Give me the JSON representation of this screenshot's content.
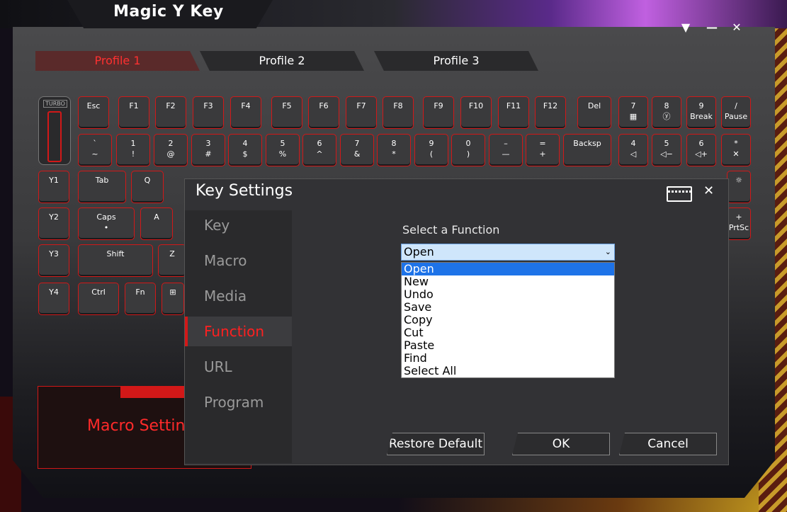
{
  "app": {
    "title": "Magic Y Key",
    "window_controls": {
      "dropdown": "▼",
      "minimize": "—",
      "close": "✕"
    }
  },
  "profiles": [
    {
      "label": "Profile 1",
      "active": true
    },
    {
      "label": "Profile 2",
      "active": false
    },
    {
      "label": "Profile 3",
      "active": false
    }
  ],
  "keyboard": {
    "turbo_label": "TURBO",
    "row_fn": [
      "Esc",
      "F1",
      "F2",
      "F3",
      "F4",
      "F5",
      "F6",
      "F7",
      "F8",
      "F9",
      "F10",
      "F11",
      "F12",
      "Del"
    ],
    "row_num": [
      {
        "top": "`",
        "bot": "~"
      },
      {
        "top": "1",
        "bot": "!"
      },
      {
        "top": "2",
        "bot": "@"
      },
      {
        "top": "3",
        "bot": "#"
      },
      {
        "top": "4",
        "bot": "$"
      },
      {
        "top": "5",
        "bot": "%"
      },
      {
        "top": "6",
        "bot": "^"
      },
      {
        "top": "7",
        "bot": "&"
      },
      {
        "top": "8",
        "bot": "*"
      },
      {
        "top": "9",
        "bot": "("
      },
      {
        "top": "0",
        "bot": ")"
      },
      {
        "top": "–",
        "bot": "—"
      },
      {
        "top": "=",
        "bot": "+"
      },
      {
        "top": "Backsp",
        "bot": ""
      }
    ],
    "numpad_row1": [
      {
        "top": "7",
        "bot": "▦"
      },
      {
        "top": "8",
        "bot": "ⓨ"
      },
      {
        "top": "9",
        "bot": "Break"
      },
      {
        "top": "/",
        "bot": "Pause"
      }
    ],
    "numpad_row2": [
      {
        "top": "4",
        "bot": "◁"
      },
      {
        "top": "5",
        "bot": "◁−"
      },
      {
        "top": "6",
        "bot": "◁+"
      },
      {
        "top": "*",
        "bot": "✕"
      }
    ],
    "y_keys": [
      "Y1",
      "Y2",
      "Y3",
      "Y4"
    ],
    "row_tab": [
      "Tab",
      "Q"
    ],
    "row_caps": [
      "Caps",
      "A"
    ],
    "row_shift": [
      "Shift",
      "Z"
    ],
    "row_ctrl": [
      "Ctrl",
      "Fn"
    ],
    "right_side": [
      "+",
      "PrtSc"
    ]
  },
  "macro_panel": {
    "title": "Macro Settings"
  },
  "dialog": {
    "title": "Key Settings",
    "nav": [
      {
        "label": "Key",
        "active": false
      },
      {
        "label": "Macro",
        "active": false
      },
      {
        "label": "Media",
        "active": false
      },
      {
        "label": "Function",
        "active": true
      },
      {
        "label": "URL",
        "active": false
      },
      {
        "label": "Program",
        "active": false
      }
    ],
    "select_label": "Select a Function",
    "select_value": "Open",
    "options": [
      "Open",
      "New",
      "Undo",
      "Save",
      "Copy",
      "Cut",
      "Paste",
      "Find",
      "Select All"
    ],
    "buttons": {
      "restore": "Restore Default",
      "ok": "OK",
      "cancel": "Cancel"
    }
  },
  "colors": {
    "accent": "#d21818",
    "highlight": "#1e73e8"
  }
}
